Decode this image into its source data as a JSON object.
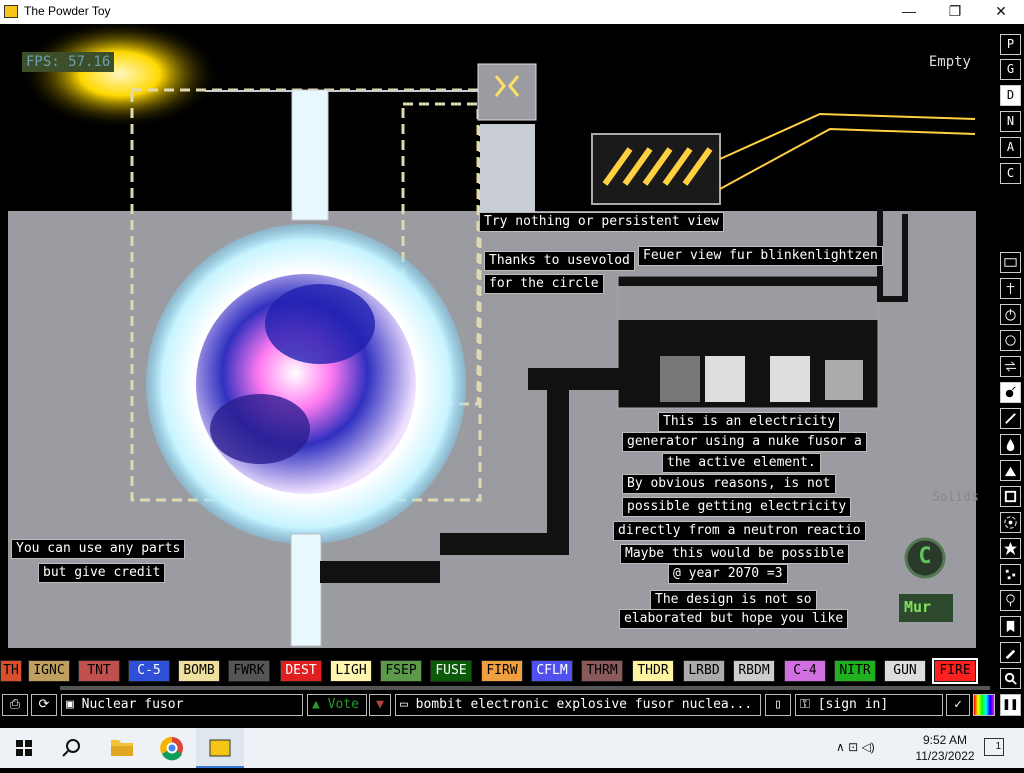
{
  "window": {
    "title": "The Powder Toy",
    "minimize": "—",
    "maximize": "❐",
    "close": "✕"
  },
  "hud": {
    "fps": "FPS: 57.16",
    "hover_element": "Empty",
    "category": "Solids"
  },
  "signs": [
    "Try nothing or persistent view",
    "Thanks to usevolod",
    "for the circle",
    "Feuer view fur blinkenlightzen",
    "This is an electricity",
    "generator using a nuke fusor a",
    "the active element.",
    "By obvious reasons, is not",
    "possible getting electricity",
    "directly from a neutron reactio",
    "Maybe this would be possible",
    "@ year 2070 =3",
    "The design is not so",
    "elaborated but hope you like",
    "You can use any parts",
    "but give credit"
  ],
  "game_badges": {
    "c_badge": "C",
    "mur_badge": "Mur"
  },
  "right_menu": {
    "render_buttons": [
      "P",
      "G",
      "D",
      "N",
      "A",
      "C"
    ],
    "categories": [
      "walls-icon",
      "electronics-icon",
      "powered-icon",
      "sensors-icon",
      "force-icon",
      "explosives-icon",
      "gases-icon",
      "liquids-icon",
      "powders-icon",
      "solids-icon",
      "radioactive-icon",
      "special-icon",
      "life-icon",
      "tools-icon",
      "favorites-icon",
      "deco-icon",
      "search-icon"
    ]
  },
  "elements": [
    {
      "label": "TH",
      "color": "#d94f2c",
      "text": "#000"
    },
    {
      "label": "IGNC",
      "color": "#c0a060",
      "text": "#000"
    },
    {
      "label": "TNT",
      "color": "#c0504d",
      "text": "#000"
    },
    {
      "label": "C-5",
      "color": "#2e4fd6",
      "text": "#fff"
    },
    {
      "label": "BOMB",
      "color": "#f0e0a0",
      "text": "#000"
    },
    {
      "label": "FWRK",
      "color": "#555555",
      "text": "#000"
    },
    {
      "label": "DEST",
      "color": "#e02020",
      "text": "#fff"
    },
    {
      "label": "LIGH",
      "color": "#fff4b0",
      "text": "#000"
    },
    {
      "label": "FSEP",
      "color": "#5a9a4a",
      "text": "#000"
    },
    {
      "label": "FUSE",
      "color": "#0a5a0a",
      "text": "#fff"
    },
    {
      "label": "FIRW",
      "color": "#f0a040",
      "text": "#000"
    },
    {
      "label": "CFLM",
      "color": "#5050f0",
      "text": "#fff"
    },
    {
      "label": "THRM",
      "color": "#8a5a5a",
      "text": "#000"
    },
    {
      "label": "THDR",
      "color": "#fff4a0",
      "text": "#000"
    },
    {
      "label": "LRBD",
      "color": "#aaaaaa",
      "text": "#000"
    },
    {
      "label": "RBDM",
      "color": "#cccccc",
      "text": "#000"
    },
    {
      "label": "C-4",
      "color": "#d070e0",
      "text": "#000"
    },
    {
      "label": "NITR",
      "color": "#20b020",
      "text": "#000"
    },
    {
      "label": "GUN",
      "color": "#dddddd",
      "text": "#000"
    },
    {
      "label": "FIRE",
      "color": "#ff2020",
      "text": "#000"
    }
  ],
  "bottom": {
    "save_name": "Nuclear fusor",
    "vote_label": "Vote",
    "tags": "bombit electronic explosive fusor nuclea...",
    "sign_in": "[sign in]",
    "pause_label": "❚❚"
  },
  "taskbar": {
    "time": "9:52 AM",
    "date": "11/23/2022",
    "notifications": "1"
  }
}
